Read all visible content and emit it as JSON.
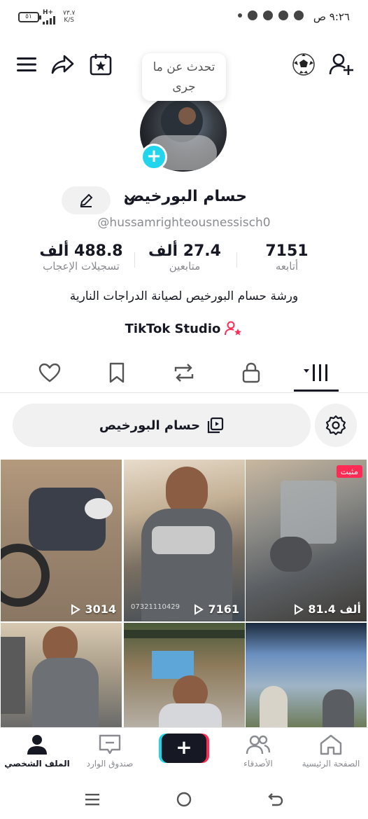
{
  "status_bar": {
    "time": "٩:٢٦ ص",
    "battery": "٥١",
    "network": "H+",
    "speed_value": "٧٣.٧",
    "speed_unit": "K/S"
  },
  "header": {
    "bubble_text": "تحدث عن ما جرى"
  },
  "profile": {
    "name": "حسام البورخيص",
    "handle": "@hussamrighteousnessisch0",
    "stats": [
      {
        "value": "7151",
        "label": "أتابعه"
      },
      {
        "value": "27.4 ألف",
        "label": "متابعين"
      },
      {
        "value": "488.8 ألف",
        "label": "تسجيلات الإعجاب"
      }
    ],
    "bio": "ورشة حسام البورخيص لصيانة الدراجات النارية",
    "studio_label": "TikTok Studio"
  },
  "playlist": {
    "label": "حسام البورخيص"
  },
  "videos": [
    {
      "views": "81.4 ألف",
      "badge": "مثبت"
    },
    {
      "views": "7161",
      "overlay": "07321110429"
    },
    {
      "views": "3014"
    },
    {
      "views": ""
    },
    {
      "views": ""
    },
    {
      "views": ""
    }
  ],
  "bottom_nav": {
    "home": "الصفحة الرئيسية",
    "friends": "الأصدقاء",
    "create": "+",
    "inbox": "صندوق الوارد",
    "profile": "الملف الشخصي"
  },
  "colors": {
    "accent_red": "#fe2c55",
    "accent_cyan": "#20d5ec",
    "text": "#161823",
    "muted": "#8a8b91"
  }
}
